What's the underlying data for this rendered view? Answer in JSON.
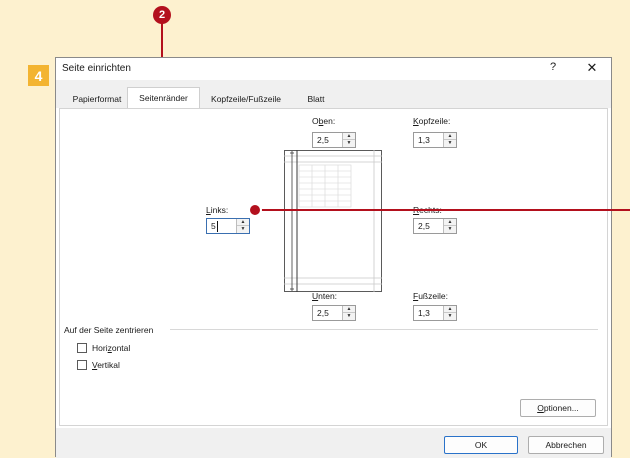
{
  "callouts": {
    "step_number": "4",
    "tab_marker": "2"
  },
  "dialog": {
    "title": "Seite einrichten",
    "help_label": "?",
    "close_label": "✕",
    "tabs": [
      {
        "label": "Papierformat",
        "active": false
      },
      {
        "label": "Seitenränder",
        "active": true
      },
      {
        "label": "Kopfzeile/Fußzeile",
        "active": false
      },
      {
        "label": "Blatt",
        "active": false
      }
    ],
    "margins": {
      "top": {
        "label_pre": "O",
        "label_u": "b",
        "label_post": "en:",
        "value": "2,5"
      },
      "header": {
        "label_pre": "",
        "label_u": "K",
        "label_post": "opfzeile:",
        "value": "1,3"
      },
      "left": {
        "label_pre": "",
        "label_u": "L",
        "label_post": "inks:",
        "value": "5"
      },
      "right": {
        "label_pre": "",
        "label_u": "R",
        "label_post": "echts:",
        "value": "2,5"
      },
      "bottom": {
        "label_pre": "",
        "label_u": "U",
        "label_post": "nten:",
        "value": "2,5"
      },
      "footer": {
        "label_pre": "",
        "label_u": "F",
        "label_post": "ußzeile:",
        "value": "1,3"
      }
    },
    "center_section": {
      "title": "Auf der Seite zentrieren",
      "horizontal": {
        "label_pre": "Hori",
        "label_u": "z",
        "label_post": "ontal",
        "checked": false
      },
      "vertical": {
        "label_pre": "",
        "label_u": "V",
        "label_post": "ertikal",
        "checked": false
      }
    },
    "options_button": {
      "label_u": "O",
      "label_post": "ptionen..."
    },
    "ok_button": "OK",
    "cancel_button": "Abbrechen"
  }
}
